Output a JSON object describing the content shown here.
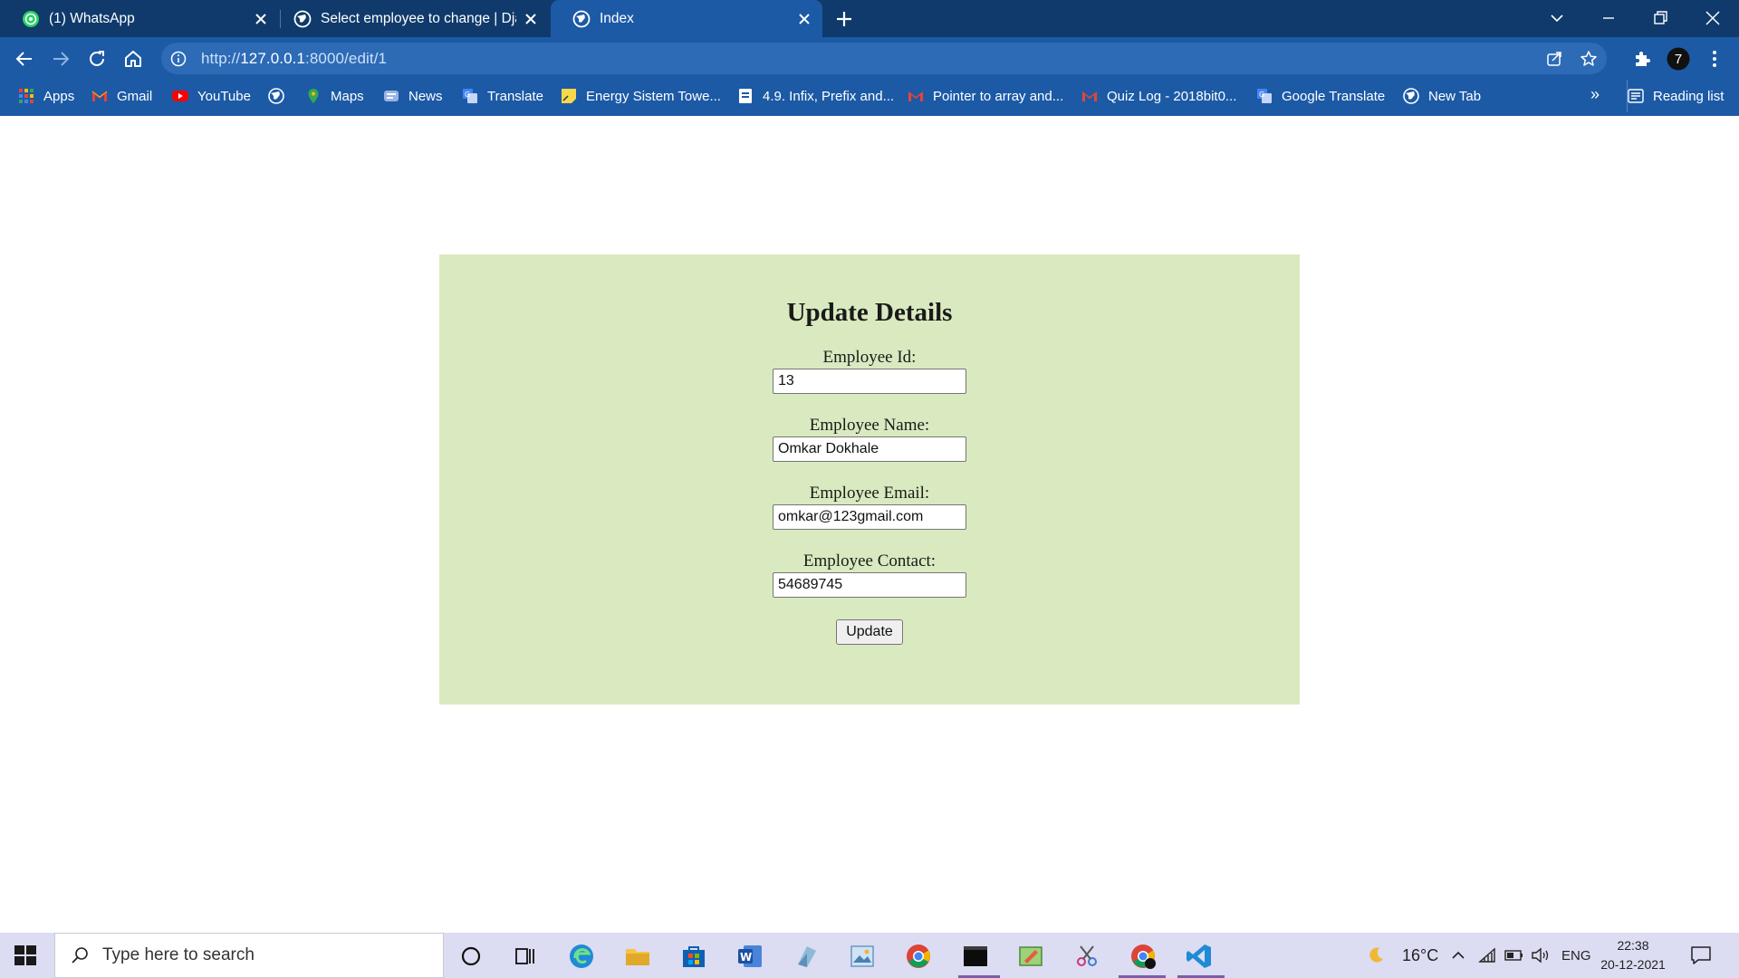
{
  "tabs": [
    {
      "title": "(1) WhatsApp",
      "icon": "whatsapp-icon",
      "active": false
    },
    {
      "title": "Select employee to change | Djan",
      "icon": "globe-icon",
      "active": false
    },
    {
      "title": "Index",
      "icon": "globe-icon",
      "active": true
    }
  ],
  "address_bar": {
    "url_prefix": "http://",
    "url_host": "127.0.0.1",
    "url_rest": ":8000/edit/1"
  },
  "profile_initial": "7",
  "bookmarks": [
    {
      "label": "Apps",
      "icon": "apps-grid-icon"
    },
    {
      "label": "Gmail",
      "icon": "gmail-icon"
    },
    {
      "label": "YouTube",
      "icon": "youtube-icon"
    },
    {
      "label": "",
      "icon": "globe-icon"
    },
    {
      "label": "Maps",
      "icon": "maps-icon"
    },
    {
      "label": "News",
      "icon": "news-icon"
    },
    {
      "label": "Translate",
      "icon": "translate-icon"
    },
    {
      "label": "Energy Sistem Towe...",
      "icon": "note-icon"
    },
    {
      "label": "4.9. Infix, Prefix and...",
      "icon": "document-icon"
    },
    {
      "label": "Pointer to array and...",
      "icon": "gmail-icon"
    },
    {
      "label": "Quiz Log - 2018bit0...",
      "icon": "gmail-icon"
    },
    {
      "label": "Google Translate",
      "icon": "translate-icon"
    },
    {
      "label": "New Tab",
      "icon": "globe-icon"
    }
  ],
  "bookmarks_more": "»",
  "reading_list": "Reading list",
  "form": {
    "title": "Update Details",
    "fields": [
      {
        "label": "Employee Id:",
        "value": "13"
      },
      {
        "label": "Employee Name:",
        "value": "Omkar Dokhale"
      },
      {
        "label": "Employee Email:",
        "value": "omkar@123gmail.com"
      },
      {
        "label": "Employee Contact:",
        "value": "54689745"
      }
    ],
    "submit_label": "Update"
  },
  "taskbar": {
    "search_placeholder": "Type here to search",
    "weather": "16°C",
    "language": "ENG",
    "time": "22:38",
    "date": "20-12-2021"
  },
  "colors": {
    "tabstrip": "#0f3a6b",
    "toolbar": "#1c5aa6",
    "card_background": "#d9eac0",
    "taskbar": "#dcdcf2"
  }
}
